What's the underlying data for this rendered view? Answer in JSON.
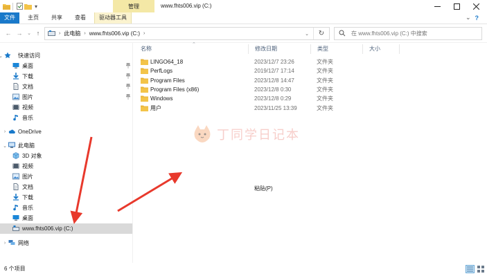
{
  "titlebar": {
    "title": "www.fhts006.vip (C:)",
    "context_tab": "管理",
    "buttons": [
      "minimize-icon",
      "maximize-icon",
      "close-icon"
    ]
  },
  "ribbon": {
    "tabs": [
      "文件",
      "主页",
      "共享",
      "查看",
      "驱动器工具"
    ]
  },
  "address": {
    "crumbs": [
      "此电脑",
      "www.fhts006.vip (C:)"
    ],
    "search_placeholder": "在 www.fhts006.vip (C:) 中搜索"
  },
  "nav": {
    "items": [
      {
        "label": "快速访问",
        "icon": "star-icon",
        "pinned": false
      },
      {
        "label": "桌面",
        "icon": "desktop-icon",
        "pinned": true
      },
      {
        "label": "下载",
        "icon": "download-icon",
        "pinned": true
      },
      {
        "label": "文档",
        "icon": "document-icon",
        "pinned": true
      },
      {
        "label": "图片",
        "icon": "pictures-icon",
        "pinned": true
      },
      {
        "label": "视频",
        "icon": "video-icon",
        "pinned": false
      },
      {
        "label": "音乐",
        "icon": "music-icon",
        "pinned": false
      },
      {
        "label": "OneDrive",
        "icon": "cloud-icon",
        "pinned": false
      },
      {
        "label": "此电脑",
        "icon": "computer-icon",
        "pinned": false
      },
      {
        "label": "3D 对象",
        "icon": "cube-icon",
        "pinned": false
      },
      {
        "label": "视频",
        "icon": "video-icon",
        "pinned": false
      },
      {
        "label": "图片",
        "icon": "pictures-icon",
        "pinned": false
      },
      {
        "label": "文档",
        "icon": "document-icon",
        "pinned": false
      },
      {
        "label": "下载",
        "icon": "download-icon",
        "pinned": false
      },
      {
        "label": "音乐",
        "icon": "music-icon",
        "pinned": false
      },
      {
        "label": "桌面",
        "icon": "desktop-icon",
        "pinned": false
      },
      {
        "label": "www.fhts006.vip (C:)",
        "icon": "drive-icon",
        "pinned": false
      },
      {
        "label": "网络",
        "icon": "network-icon",
        "pinned": false
      }
    ]
  },
  "content": {
    "columns": [
      "名称",
      "修改日期",
      "类型",
      "大小"
    ],
    "rows": [
      {
        "name": "LINGO64_18",
        "date": "2023/12/7 23:26",
        "type": "文件夹"
      },
      {
        "name": "PerfLogs",
        "date": "2019/12/7 17:14",
        "type": "文件夹"
      },
      {
        "name": "Program Files",
        "date": "2023/12/8 14:47",
        "type": "文件夹"
      },
      {
        "name": "Program Files (x86)",
        "date": "2023/12/8 0:30",
        "type": "文件夹"
      },
      {
        "name": "Windows",
        "date": "2023/12/8 0:29",
        "type": "文件夹"
      },
      {
        "name": "用户",
        "date": "2023/11/25 13:39",
        "type": "文件夹"
      }
    ],
    "context_label": "粘贴(P)",
    "watermark": "丁同学日记本"
  },
  "status": {
    "text": "6 个项目"
  },
  "colors": {
    "accent": "#1979ca",
    "selected": "#d9d9d9",
    "folder": "#f3c449",
    "arrow": "#e8392c"
  }
}
